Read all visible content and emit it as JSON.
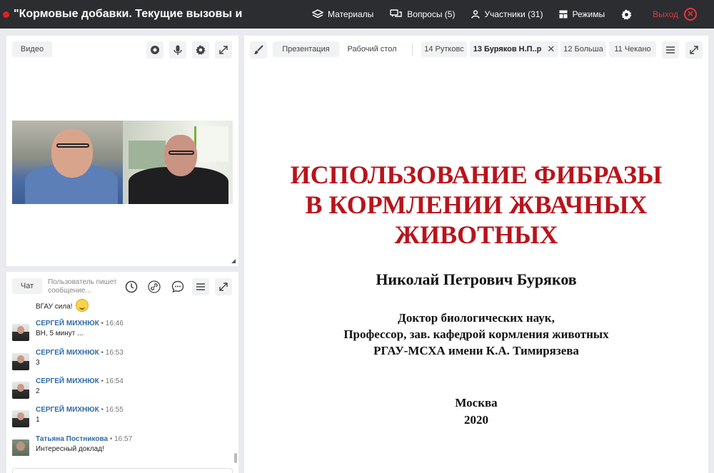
{
  "topbar": {
    "title": "\"Кормовые добавки. Текущие вызовы и",
    "nav": {
      "materials": "Материалы",
      "questions": "Вопросы (5)",
      "participants": "Участники (31)",
      "modes": "Режимы",
      "exit": "Выход"
    }
  },
  "video_panel": {
    "label": "Видео"
  },
  "chat_panel": {
    "label": "Чат",
    "typing_line1": "Пользователь пишет",
    "typing_line2": "сообщение...",
    "messages": [
      {
        "author": "",
        "time": "",
        "text": "ВГАУ сила!"
      },
      {
        "author": "СЕРГЕЙ МИХНЮК",
        "time": "• 16:46",
        "text": "ВН, 5 минут ..."
      },
      {
        "author": "СЕРГЕЙ МИХНЮК",
        "time": "• 16:53",
        "text": "3"
      },
      {
        "author": "СЕРГЕЙ МИХНЮК",
        "time": "• 16:54",
        "text": "2"
      },
      {
        "author": "СЕРГЕЙ МИХНЮК",
        "time": "• 16:55",
        "text": "1"
      },
      {
        "author": "Татьяна Постникова",
        "time": "• 16:57",
        "text": "Интересный доклад!"
      }
    ]
  },
  "main_panel": {
    "tabs": {
      "presentation": "Презентация",
      "desktop": "Рабочий стол",
      "t14": "14 Рутковс",
      "t13": "13 Буряков Н.П..р",
      "t12": "12 Больша",
      "t11": "11 Чекано"
    },
    "slide": {
      "title_line1": "ИСПОЛЬЗОВАНИЕ ФИБРАЗЫ",
      "title_line2": "В КОРМЛЕНИИ ЖВАЧНЫХ",
      "title_line3": "ЖИВОТНЫХ",
      "author": "Николай Петрович Буряков",
      "degree_line1": "Доктор биологических наук,",
      "degree_line2": "Профессор, зав. кафедрой кормления животных",
      "degree_line3": "РГАУ-МСХА имени К.А. Тимирязева",
      "city": "Москва",
      "year": "2020"
    }
  },
  "colors": {
    "topbar": "#2b2d30",
    "accent_red": "#e8343c",
    "slide_title": "#b8141c",
    "author_link": "#2f6aa8"
  }
}
